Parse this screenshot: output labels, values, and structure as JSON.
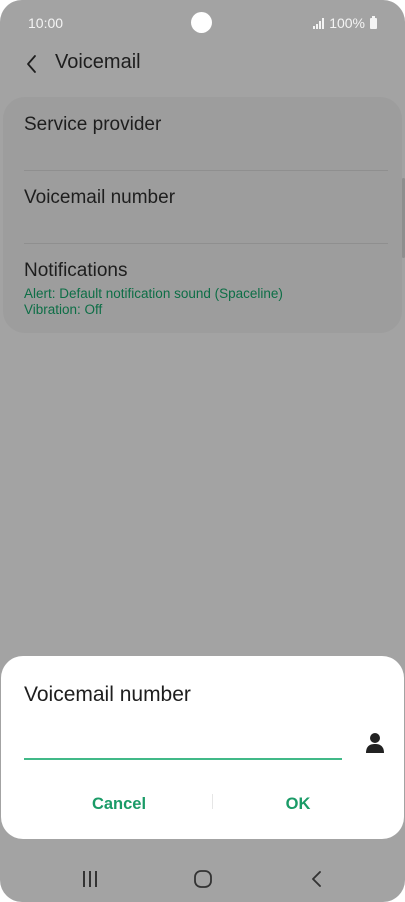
{
  "status_bar": {
    "time": "10:00",
    "battery_text": "100%"
  },
  "header": {
    "title": "Voicemail",
    "back_icon": "chevron-left-icon"
  },
  "settings": {
    "items": [
      {
        "title": "Service provider"
      },
      {
        "title": "Voicemail number"
      },
      {
        "title": "Notifications",
        "subtitles": [
          "Alert: Default notification sound (Spaceline)",
          "Vibration: Off"
        ]
      }
    ]
  },
  "dialog": {
    "title": "Voicemail number",
    "input_value": "",
    "contact_icon": "person-icon",
    "cancel_label": "Cancel",
    "ok_label": "OK"
  },
  "navbar": {
    "recent_icon": "recent-apps-icon",
    "home_icon": "home-icon",
    "back_icon": "back-icon"
  },
  "colors": {
    "accent": "#1a9b67",
    "input_underline": "#41b988",
    "subtitle_green": "#0d6e46",
    "dim_background": "#a3a3a3"
  }
}
